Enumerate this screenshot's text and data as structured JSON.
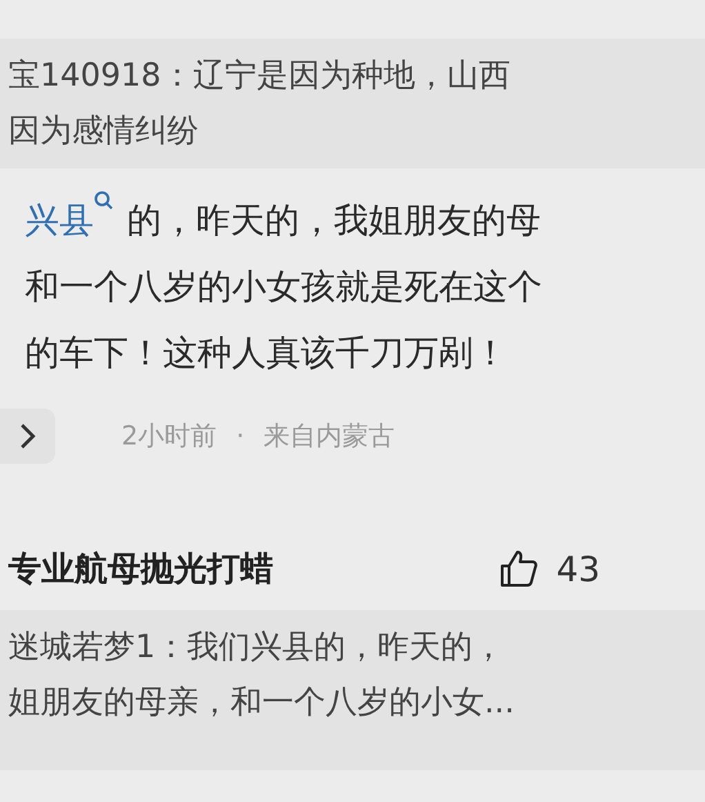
{
  "quoted_reply": {
    "lines": [
      "宝140918：辽宁是因为种地，山西",
      "因为感情纠纷"
    ]
  },
  "comment": {
    "link": "兴县",
    "lines": [
      "的，昨天的，我姐朋友的母",
      "和一个八岁的小女孩就是死在这个",
      "的车下！这种人真该千刀万剐！"
    ],
    "time": "2小时前",
    "separator": "·",
    "location": "来自内蒙古"
  },
  "next_comment": {
    "username": "专业航母抛光打蜡",
    "likes": "43",
    "quoted_reply": {
      "lines": [
        "迷城若梦1：我们兴县的，昨天的，",
        "姐朋友的母亲，和一个八岁的小女..."
      ]
    }
  }
}
